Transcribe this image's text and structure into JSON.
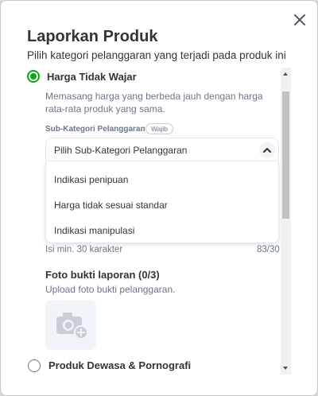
{
  "modal": {
    "title": "Laporkan Produk",
    "subtitle": "Pilih kategori pelanggaran yang terjadi pada produk ini"
  },
  "options": [
    {
      "label": "Harga Tidak Wajar",
      "selected": true,
      "description": "Memasang harga yang berbeda jauh dengan harga rata-rata produk yang sama."
    },
    {
      "label": "Produk Dewasa & Pornografi",
      "selected": false
    }
  ],
  "subcategory": {
    "label": "Sub-Kategori Pelanggaran",
    "badge": "Wajib",
    "placeholder": "Pilih Sub-Kategori Pelanggaran",
    "items": [
      "Indikasi penipuan",
      "Harga tidak sesuai standar",
      "Indikasi manipulasi"
    ]
  },
  "report": {
    "min_hint": "Isi min. 30 karakter",
    "counter": "83/30"
  },
  "photo": {
    "title": "Foto bukti laporan (0/3)",
    "subtitle": "Upload foto bukti pelanggaran."
  },
  "colors": {
    "accent": "#03ac0e",
    "text": "#31353b",
    "muted": "#6d7588"
  },
  "icons": {
    "close": "close-icon",
    "chevron": "chevron-up-icon",
    "camera": "camera-add-icon"
  }
}
